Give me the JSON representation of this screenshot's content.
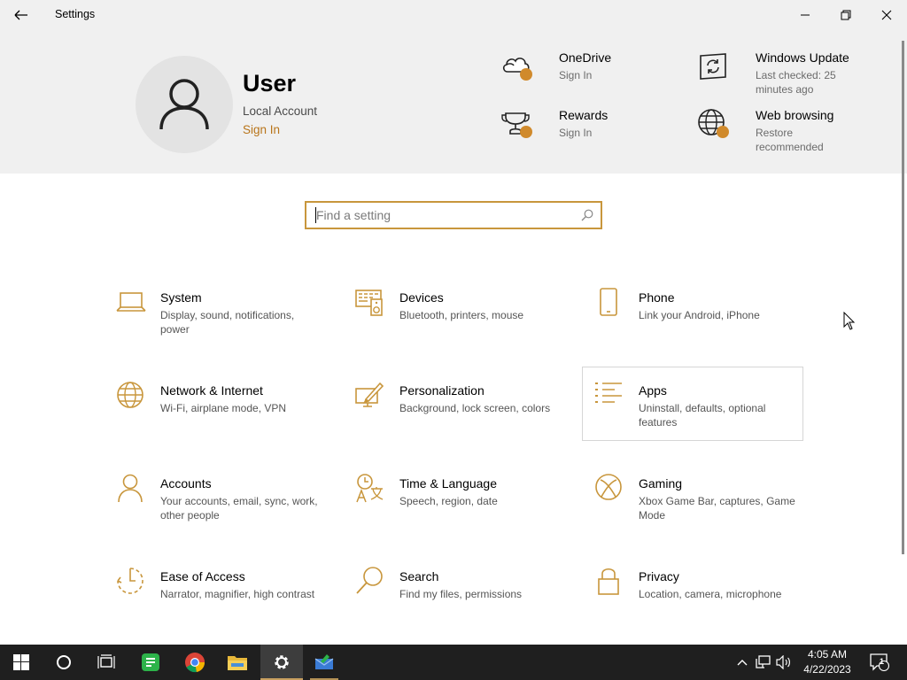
{
  "window": {
    "title": "Settings"
  },
  "user": {
    "name": "User",
    "account_type": "Local Account",
    "sign_in": "Sign In"
  },
  "header_items": [
    {
      "title": "OneDrive",
      "subtitle": "Sign In",
      "icon": "cloud-icon"
    },
    {
      "title": "Windows Update",
      "subtitle": "Last checked: 25 minutes ago",
      "icon": "refresh-icon"
    },
    {
      "title": "Rewards",
      "subtitle": "Sign In",
      "icon": "trophy-icon"
    },
    {
      "title": "Web browsing",
      "subtitle": "Restore recommended",
      "icon": "globe-icon"
    }
  ],
  "search": {
    "placeholder": "Find a setting"
  },
  "categories": [
    {
      "name": "System",
      "desc": "Display, sound, notifications, power"
    },
    {
      "name": "Devices",
      "desc": "Bluetooth, printers, mouse"
    },
    {
      "name": "Phone",
      "desc": "Link your Android, iPhone"
    },
    {
      "name": "Network & Internet",
      "desc": "Wi-Fi, airplane mode, VPN"
    },
    {
      "name": "Personalization",
      "desc": "Background, lock screen, colors"
    },
    {
      "name": "Apps",
      "desc": "Uninstall, defaults, optional features"
    },
    {
      "name": "Accounts",
      "desc": "Your accounts, email, sync, work, other people"
    },
    {
      "name": "Time & Language",
      "desc": "Speech, region, date"
    },
    {
      "name": "Gaming",
      "desc": "Xbox Game Bar, captures, Game Mode"
    },
    {
      "name": "Ease of Access",
      "desc": "Narrator, magnifier, high contrast"
    },
    {
      "name": "Search",
      "desc": "Find my files, permissions"
    },
    {
      "name": "Privacy",
      "desc": "Location, camera, microphone"
    }
  ],
  "taskbar": {
    "apps": [
      "start-icon",
      "cortana-icon",
      "task-view-icon",
      "notes-app-icon",
      "chrome-icon",
      "file-explorer-icon",
      "settings-icon",
      "mail-app-icon"
    ],
    "time": "4:05 AM",
    "date": "4/22/2023",
    "notification_count": "1"
  },
  "colors": {
    "accent": "#c8963c",
    "link": "#b8741a",
    "header_bg": "#f0f0f0",
    "taskbar_bg": "#1f1f1f"
  }
}
